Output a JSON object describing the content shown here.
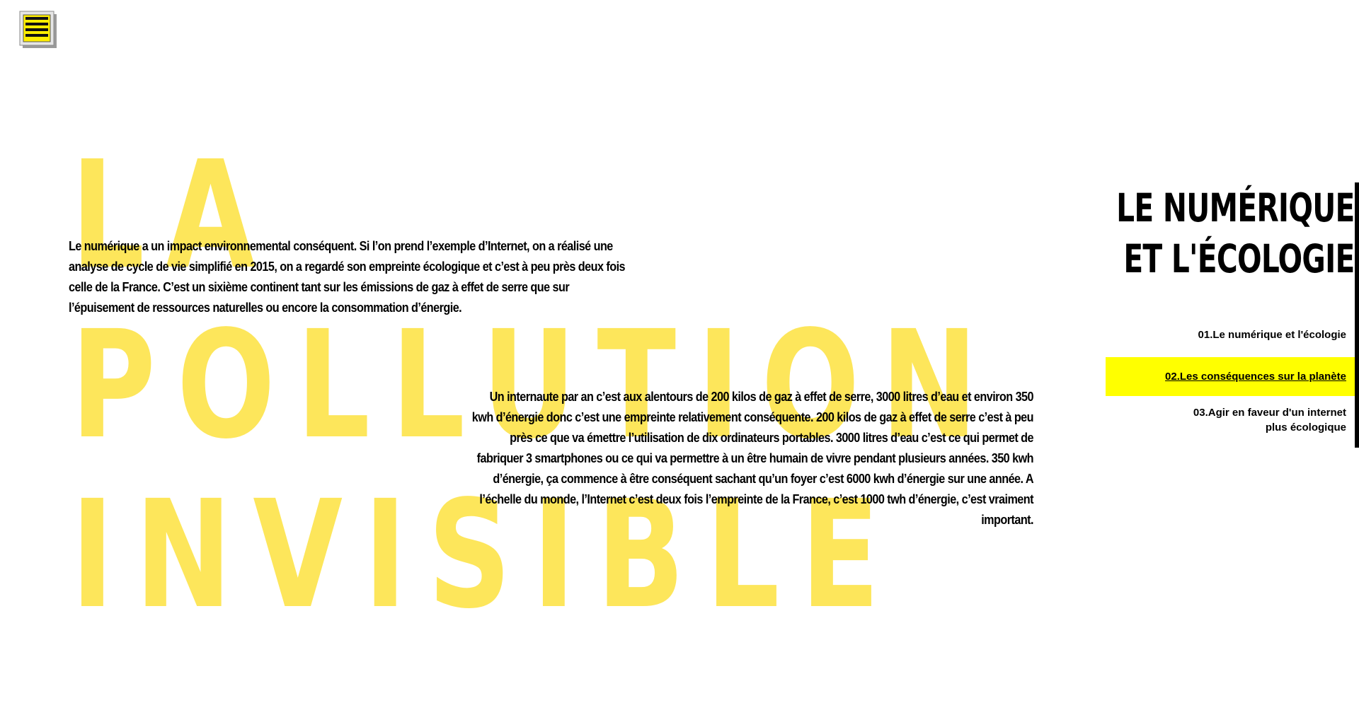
{
  "logo": {
    "icon": "cloud-grid-logo-icon",
    "lettering": [
      "cloud",
      "cloud",
      "cloud",
      "cloud"
    ]
  },
  "hero": {
    "words": [
      "LA",
      "POLLUTION",
      "INVISIBLE"
    ],
    "color": "#fde65b"
  },
  "paragraphs": {
    "first": "Le numérique a un impact environnemental conséquent. Si l’on prend l’exemple d’Internet, on a réalisé une analyse de cycle de vie simplifié en 2015, on a regardé son empreinte écologique et c’est à peu près deux fois celle de la France. C’est un sixième continent tant sur les émissions de gaz à effet de serre que sur l’épuisement de ressources naturelles ou encore la consommation d’énergie.",
    "second": "Un internaute par an c’est aux alentours de 200 kilos de gaz à effet de serre, 3000 litres d’eau et environ 350 kwh d’énergie donc c’est une empreinte relativement conséquente. 200 kilos de gaz à effet de serre c’est à peu près ce que va émettre l’utilisation de dix ordinateurs portables. 3000 litres d’eau c’est ce qui permet de fabriquer 3 smartphones ou ce qui va permettre à un être humain de vivre pendant plusieurs années. 350 kwh d’énergie, ça commence à être conséquent sachant qu’un foyer c’est 6000 kwh d’énergie sur une année. A l’échelle du monde, l’Internet c’est deux fois l’empreinte de la France, c’est 1000 twh d’énergie, c’est vraiment important."
  },
  "sidebar": {
    "title_line1": "LE NUMÉRIQUE",
    "title_line2": "ET L'ÉCOLOGIE",
    "nav": [
      {
        "label": "01.Le numérique et l'écologie"
      },
      {
        "label": "02.Les conséquences sur la planète",
        "active": true
      },
      {
        "label_line1": "03.Agir en faveur d'un internet",
        "label_line2": "plus écologique"
      }
    ],
    "active_color": "#ffff00"
  }
}
